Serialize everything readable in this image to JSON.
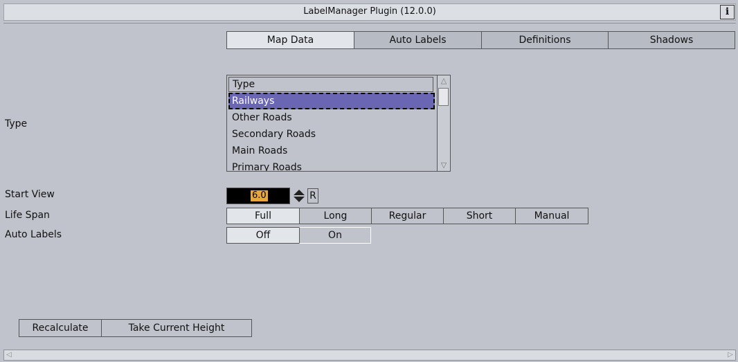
{
  "window": {
    "title": "LabelManager Plugin (12.0.0)",
    "info_label": "i"
  },
  "tabs": [
    {
      "label": "Map Data",
      "active": true
    },
    {
      "label": "Auto Labels",
      "active": false
    },
    {
      "label": "Definitions",
      "active": false
    },
    {
      "label": "Shadows",
      "active": false
    }
  ],
  "type_field": {
    "label": "Type",
    "header": "Type",
    "items": [
      "Railways",
      "Other Roads",
      "Secondary Roads",
      "Main Roads",
      "Primary Roads"
    ],
    "selected": "Railways"
  },
  "start_view": {
    "label": "Start View",
    "value": "6.0",
    "reset_label": "R"
  },
  "life_span": {
    "label": "Life Span",
    "options": [
      "Full",
      "Long",
      "Regular",
      "Short",
      "Manual"
    ],
    "selected": "Full"
  },
  "auto_labels": {
    "label": "Auto Labels",
    "options": [
      "Off",
      "On"
    ],
    "selected": "Off"
  },
  "actions": {
    "recalculate": "Recalculate",
    "take_height": "Take Current Height"
  },
  "colors": {
    "background": "#c0c3cb",
    "selection": "#6a66b4",
    "value_highlight": "#e7a73b"
  }
}
